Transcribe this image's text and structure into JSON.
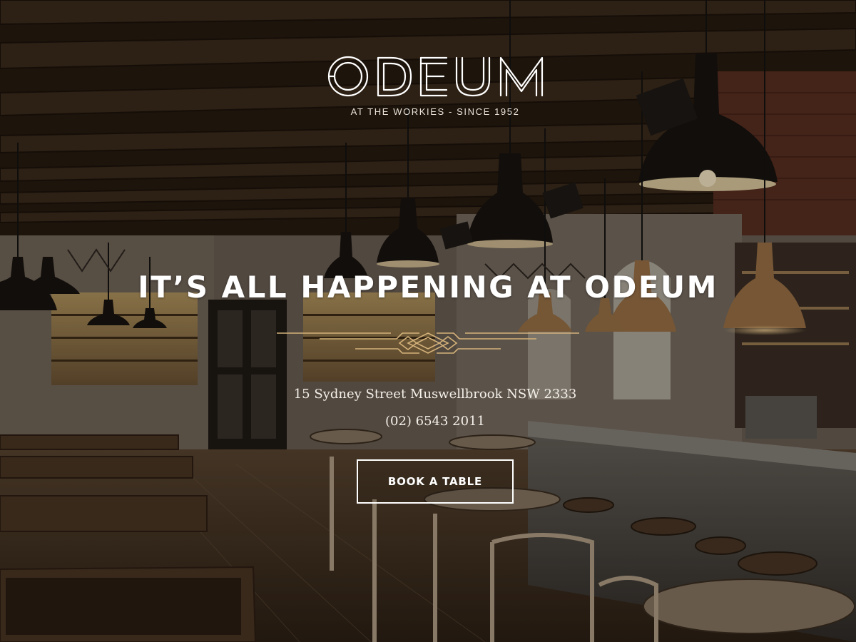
{
  "brand": {
    "logo_text": "ODEUM",
    "tagline": "AT THE WORKIES - SINCE 1952"
  },
  "hero": {
    "headline": "IT’S ALL HAPPENING AT ODEUM",
    "address": "15 Sydney Street Muswellbrook NSW 2333",
    "phone": "(02) 6543 2011",
    "cta_label": "BOOK A TABLE"
  },
  "colors": {
    "text": "#ffffff",
    "ornament_gold": "#d4b27a",
    "overlay": "#0a0603"
  },
  "icons": {
    "ornament": "art-deco-divider-icon"
  }
}
